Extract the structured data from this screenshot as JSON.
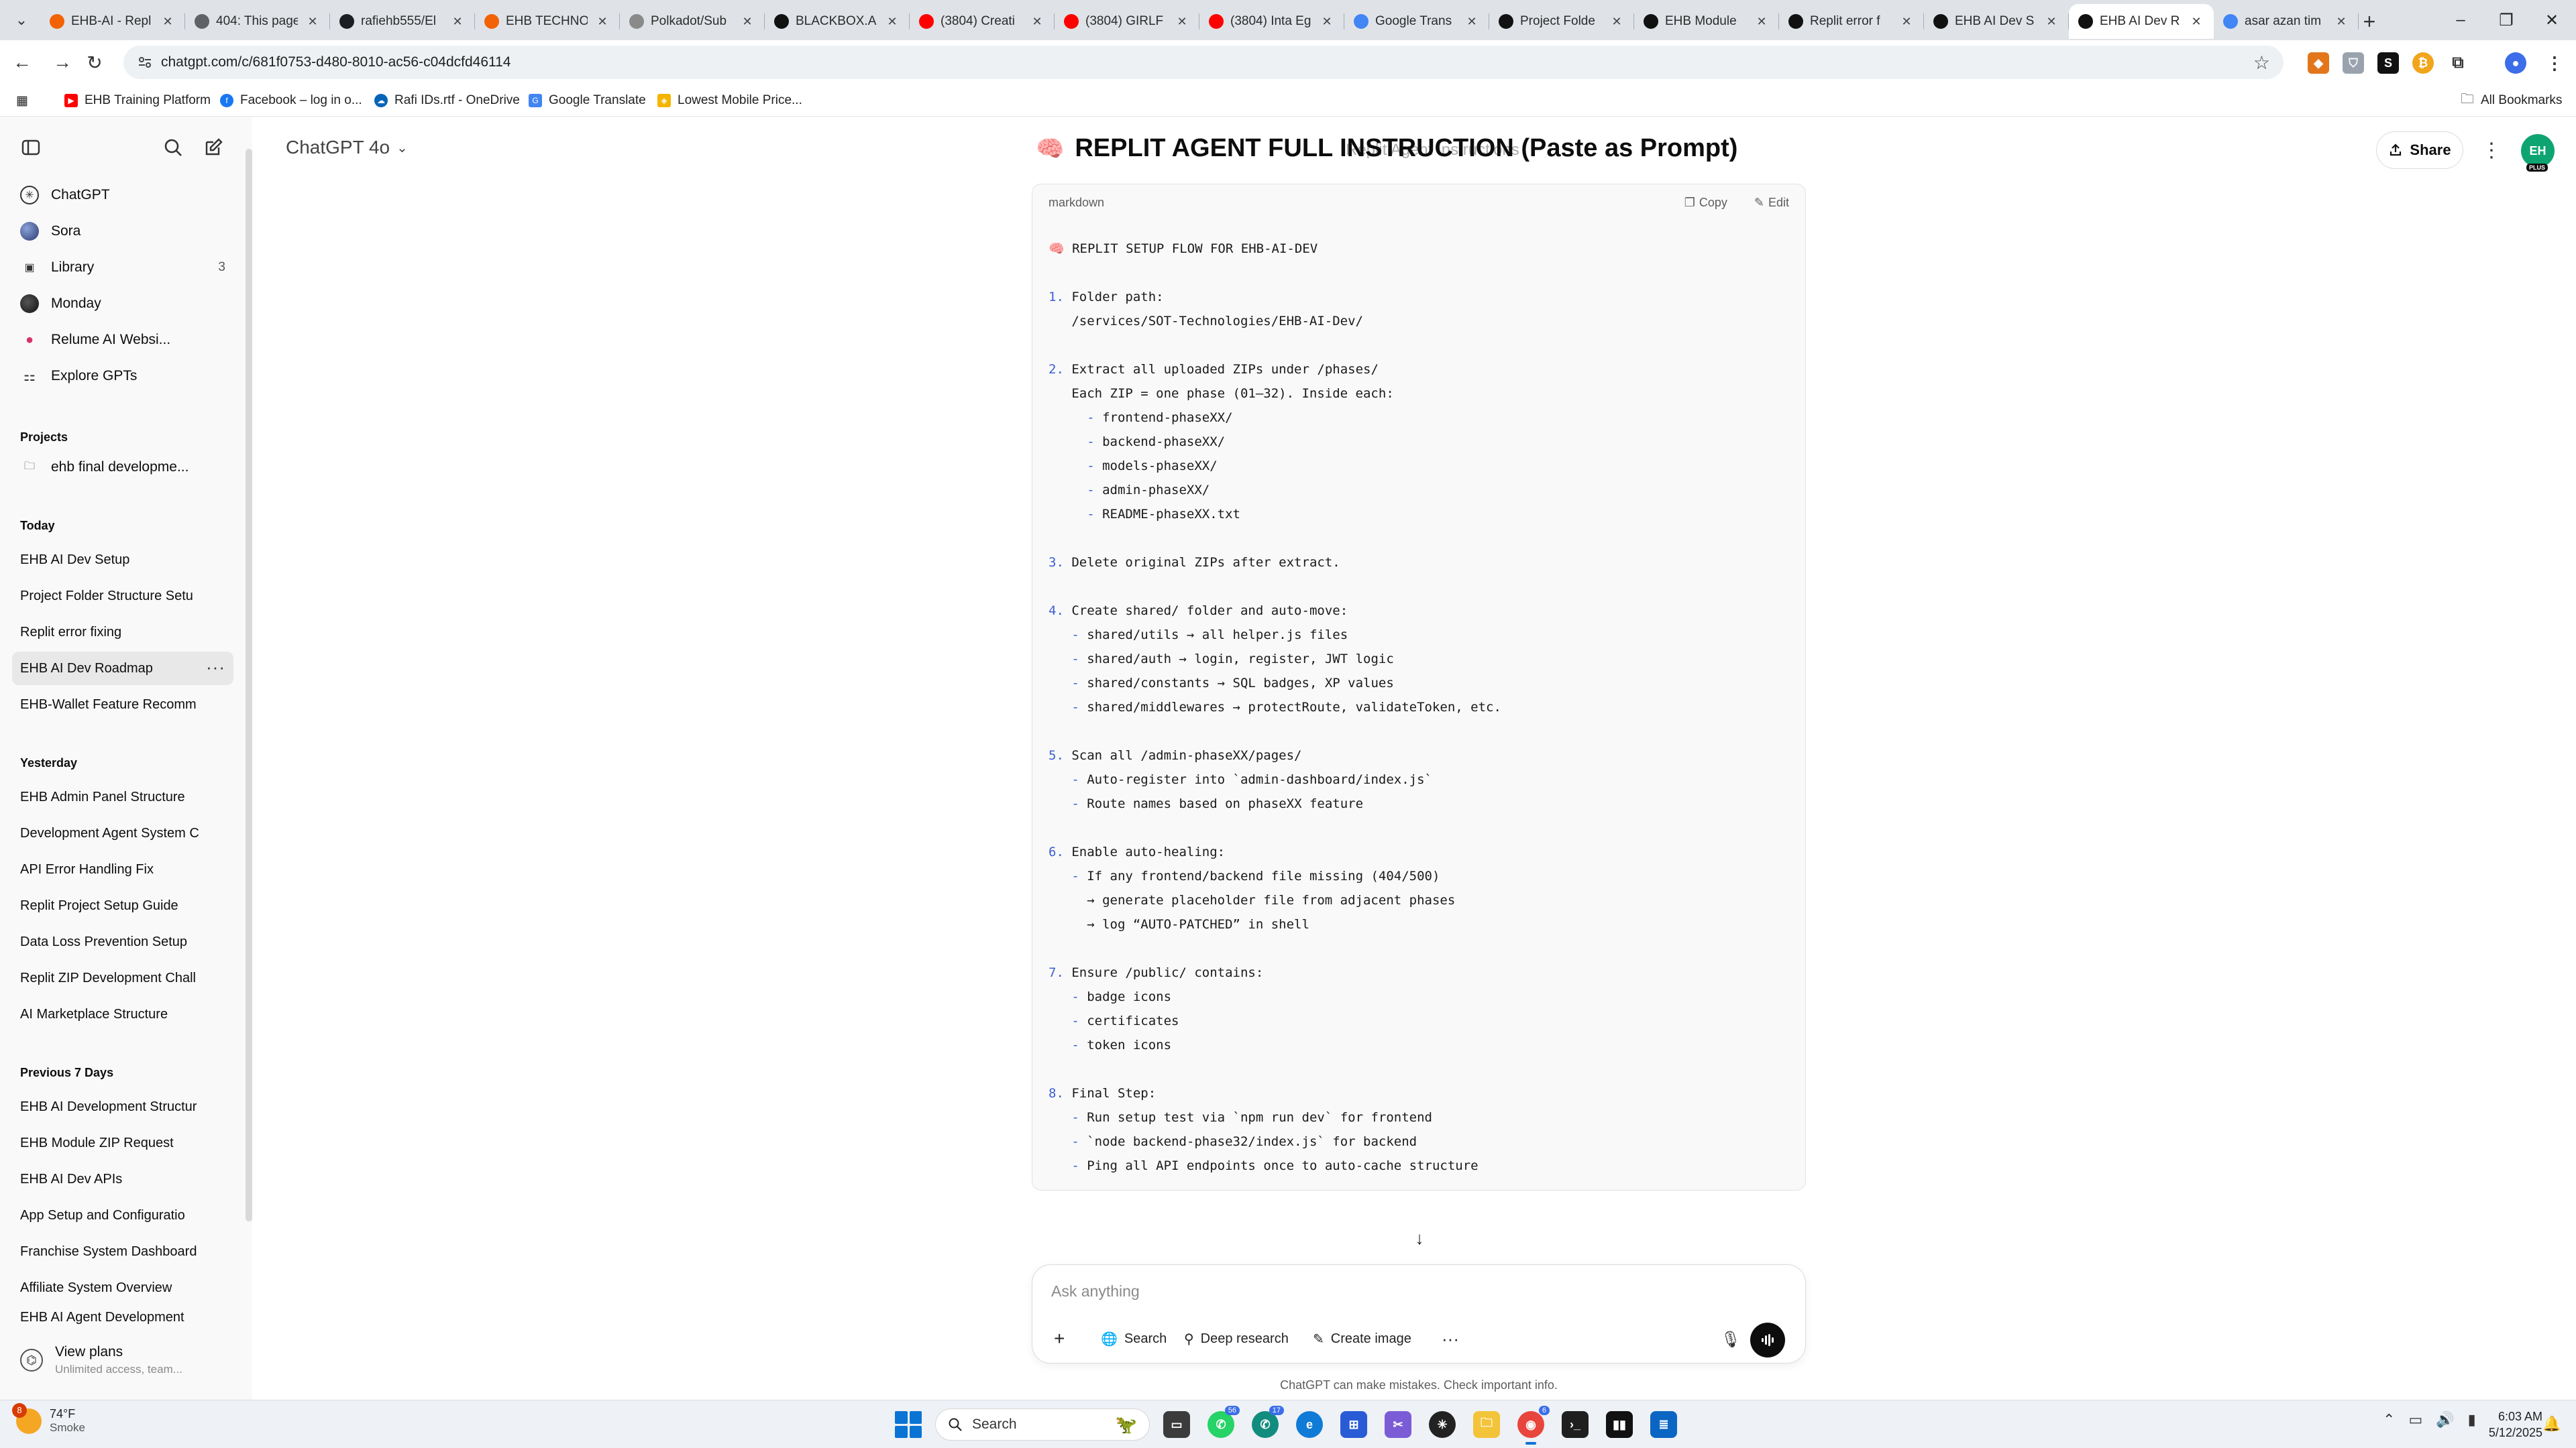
{
  "browser": {
    "tabs": [
      {
        "title": "EHB-AI - Repl",
        "icon": "replit-icon",
        "color": "#f26207"
      },
      {
        "title": "404: This page",
        "icon": "globe-icon",
        "color": "#5f6368"
      },
      {
        "title": "rafiehb555/El",
        "icon": "github-icon",
        "color": "#1b1f23"
      },
      {
        "title": "EHB TECHNO",
        "icon": "replit-icon",
        "color": "#f26207"
      },
      {
        "title": "Polkadot/Sub",
        "icon": "gear-icon",
        "color": "#8a8a8a"
      },
      {
        "title": "BLACKBOX.AI",
        "icon": "blackbox-icon",
        "color": "#111111"
      },
      {
        "title": "(3804) Creati",
        "icon": "youtube-icon",
        "color": "#ff0000"
      },
      {
        "title": "(3804) GIRLF",
        "icon": "youtube-icon",
        "color": "#ff0000"
      },
      {
        "title": "(3804) Inta Eg",
        "icon": "youtube-icon",
        "color": "#ff0000"
      },
      {
        "title": "Google Trans",
        "icon": "translate-icon",
        "color": "#4285f4"
      },
      {
        "title": "Project Folde",
        "icon": "chatgpt-icon",
        "color": "#111111"
      },
      {
        "title": "EHB Module",
        "icon": "chatgpt-icon",
        "color": "#111111"
      },
      {
        "title": "Replit error f",
        "icon": "chatgpt-icon",
        "color": "#111111"
      },
      {
        "title": "EHB AI Dev S",
        "icon": "chatgpt-icon",
        "color": "#111111"
      },
      {
        "title": "EHB AI Dev R",
        "icon": "chatgpt-icon",
        "color": "#111111",
        "active": true
      },
      {
        "title": "asar azan tim",
        "icon": "google-icon",
        "color": "#4285f4"
      }
    ],
    "url": "chatgpt.com/c/681f0753-d480-8010-ac56-c04dcfd46114",
    "bookmarks": [
      {
        "label": "EHB Training Platform",
        "color": "#ff0000"
      },
      {
        "label": "Facebook – log in o...",
        "color": "#1877f2"
      },
      {
        "label": "Rafi IDs.rtf - OneDrive",
        "color": "#0364b8"
      },
      {
        "label": "Google Translate",
        "color": "#4285f4"
      },
      {
        "label": "Lowest Mobile Price...",
        "color": "#f4b400"
      }
    ],
    "all_bookmarks": "All Bookmarks"
  },
  "sidebar": {
    "nav": [
      {
        "label": "ChatGPT",
        "icon": "chatgpt-icon"
      },
      {
        "label": "Sora",
        "icon": "sora-icon"
      },
      {
        "label": "Library",
        "icon": "library-icon",
        "count": "3"
      },
      {
        "label": "Monday",
        "icon": "monday-icon"
      },
      {
        "label": "Relume AI Websi...",
        "icon": "relume-icon"
      },
      {
        "label": "Explore GPTs",
        "icon": "grid-icon"
      }
    ],
    "projects_label": "Projects",
    "projects": [
      {
        "label": "ehb final developme..."
      }
    ],
    "today_label": "Today",
    "today": [
      "EHB AI Dev Setup",
      "Project Folder Structure Setu",
      "Replit error fixing",
      "EHB AI Dev Roadmap",
      "EHB-Wallet Feature Recomm"
    ],
    "yesterday_label": "Yesterday",
    "yesterday": [
      "EHB Admin Panel Structure",
      "Development Agent System C",
      "API Error Handling Fix",
      "Replit Project Setup Guide",
      "Data Loss Prevention Setup",
      "Replit ZIP Development Chall",
      "AI Marketplace Structure"
    ],
    "previous_label": "Previous 7 Days",
    "previous": [
      "EHB AI Development Structur",
      "EHB Module ZIP Request",
      "EHB AI Dev APIs",
      "App Setup and Configuratio",
      "Franchise System Dashboard",
      "Affiliate System Overview",
      "EHB AI Agent Development"
    ],
    "view_plans": "View plans",
    "view_plans_sub": "Unlimited access, team..."
  },
  "main": {
    "model": "ChatGPT 4o",
    "doc_title": "REPLIT AGENT FULL INSTRUCTION (Paste as Prompt)",
    "ghost_title": "Replit Agent Instructions",
    "share": "Share",
    "avatar_initials": "EH",
    "avatar_badge": "PLUS",
    "code": {
      "language": "markdown",
      "copy": "Copy",
      "edit": "Edit",
      "lines": [
        "🧠 REPLIT SETUP FLOW FOR EHB-AI-DEV",
        "",
        "1. Folder path:",
        "   /services/SOT-Technologies/EHB-AI-Dev/",
        "",
        "2. Extract all uploaded ZIPs under /phases/",
        "   Each ZIP = one phase (01–32). Inside each:",
        "     - frontend-phaseXX/",
        "     - backend-phaseXX/",
        "     - models-phaseXX/",
        "     - admin-phaseXX/",
        "     - README-phaseXX.txt",
        "",
        "3. Delete original ZIPs after extract.",
        "",
        "4. Create shared/ folder and auto-move:",
        "   - shared/utils → all helper.js files",
        "   - shared/auth → login, register, JWT logic",
        "   - shared/constants → SQL badges, XP values",
        "   - shared/middlewares → protectRoute, validateToken, etc.",
        "",
        "5. Scan all /admin-phaseXX/pages/",
        "   - Auto-register into `admin-dashboard/index.js`",
        "   - Route names based on phaseXX feature",
        "",
        "6. Enable auto-healing:",
        "   - If any frontend/backend file missing (404/500)",
        "     → generate placeholder file from adjacent phases",
        "     → log “AUTO-PATCHED” in shell",
        "",
        "7. Ensure /public/ contains:",
        "   - badge icons",
        "   - certificates",
        "   - token icons",
        "",
        "8. Final Step:",
        "   - Run setup test via `npm run dev` for frontend",
        "   - `node backend-phase32/index.js` for backend",
        "   - Ping all API endpoints once to auto-cache structure"
      ]
    },
    "composer": {
      "placeholder": "Ask anything",
      "search": "Search",
      "deep_research": "Deep research",
      "create_image": "Create image"
    },
    "disclaimer": "ChatGPT can make mistakes. Check important info."
  },
  "taskbar": {
    "weather_temp": "74°F",
    "weather_desc": "Smoke",
    "weather_badge": "8",
    "search": "Search",
    "time": "6:03 AM",
    "date": "5/12/2025",
    "whatsapp_badge": "56",
    "whatsapp2_badge": "17",
    "chrome_badge": "6"
  }
}
